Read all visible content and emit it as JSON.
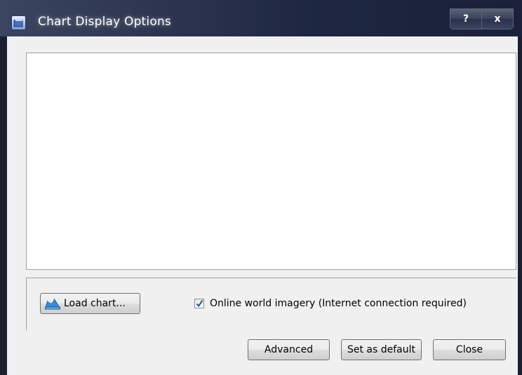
{
  "window": {
    "title": "Chart Display Options",
    "help_label": "?",
    "close_label": "x"
  },
  "chart_panel": {
    "load_button": "Load chart...",
    "imagery_checkbox_label": "Online world imagery (Internet connection required)",
    "imagery_checked": true
  },
  "footer": {
    "advanced_label": "Advanced",
    "set_default_label": "Set as default",
    "close_label": "Close"
  },
  "icons": {
    "title": "app-window-icon",
    "load": "chart-map-icon",
    "check": "check-icon"
  },
  "colors": {
    "titlebar": "#1e2742",
    "client_bg": "#f0f0f0",
    "chart_bg": "#ffffff"
  }
}
